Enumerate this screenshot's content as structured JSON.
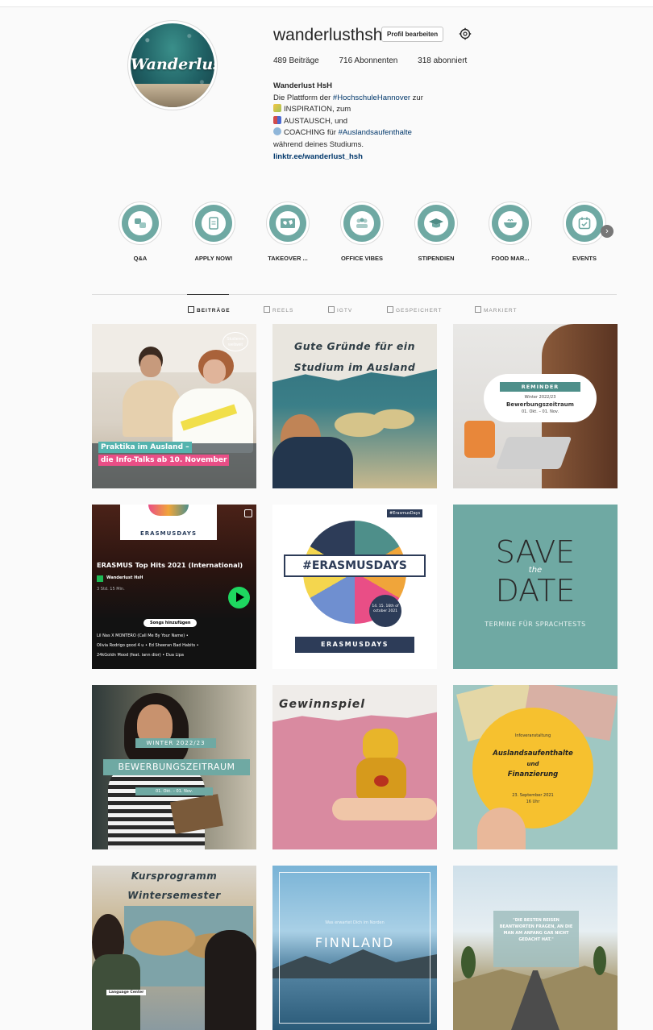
{
  "profile": {
    "username": "wanderlusthsh",
    "edit_label": "Profil bearbeiten",
    "avatar_text": "Wanderlust",
    "stats": {
      "posts": "489 Beiträge",
      "followers": "716 Abonnenten",
      "following": "318 abonniert"
    },
    "bio": {
      "name": "Wanderlust HsH",
      "line1_prefix": "Die Plattform der ",
      "line1_tag": "#HochschuleHannover",
      "line1_suffix": " zur",
      "line2": "INSPIRATION, zum",
      "line3": "AUSTAUSCH, und",
      "line4_prefix": "COACHING für ",
      "line4_tag": "#Auslandsaufenthalte",
      "line5": "während deines Studiums.",
      "link": "linktr.ee/wanderlust_hsh"
    }
  },
  "highlights": [
    {
      "label": "Q&A",
      "icon": "qa-icon"
    },
    {
      "label": "APPLY NOW!",
      "icon": "document-icon"
    },
    {
      "label": "TAKEOVER ...",
      "icon": "map-icon"
    },
    {
      "label": "OFFICE VIBES",
      "icon": "people-icon"
    },
    {
      "label": "STIPENDIEN",
      "icon": "graduation-cap-icon"
    },
    {
      "label": "FOOD MAR...",
      "icon": "food-bowl-icon"
    },
    {
      "label": "EVENTS",
      "icon": "calendar-icon"
    }
  ],
  "tabs": [
    {
      "label": "BEITRÄGE",
      "active": true
    },
    {
      "label": "REELS",
      "active": false
    },
    {
      "label": "IGTV",
      "active": false
    },
    {
      "label": "GESPEICHERT",
      "active": false
    },
    {
      "label": "MARKIERT",
      "active": false
    }
  ],
  "posts": {
    "p1": {
      "badge": "Studieren weltweit",
      "l1": "Praktika im Ausland –",
      "l2": "die Info-Talks ab 10. November"
    },
    "p2": {
      "l1": "Gute Gründe für ein",
      "l2": "Studium im Ausland"
    },
    "p3": {
      "badge": "REMINDER",
      "l1": "Winter 2022/23",
      "l2": "Bewerbungszeitraum",
      "l3": "01. Okt. – 01. Nov."
    },
    "p4": {
      "header": "ERASMUSDAYS",
      "title": "ERASMUS Top Hits 2021 (International)",
      "owner": "Wanderlust HsH",
      "meta": "3 Std. 15 Min.",
      "add": "Songs hinzufügen",
      "t1": "Lil Nas X MONTERO (Call Me By Your Name) •",
      "t2": "Olivia Rodrigo good 4 u • Ed Sheeran Bad Habits •",
      "t3": "24kGoldn Mood (feat. iann dior) • Dua Lipa"
    },
    "p5": {
      "tag": "#ErasmusDays",
      "banner": "#ERASMUSDAYS",
      "dates": "14. 15. 16th of october 2021",
      "footer": "ERASMUSDAYS"
    },
    "p6": {
      "l1": "SAVE",
      "l2": "the",
      "l3": "DATE",
      "sub": "TERMINE FÜR SPRACHTESTS"
    },
    "p7": {
      "l1": "WINTER 2022/23",
      "l2": "BEWERBUNGSZEITRAUM",
      "l3": "01. Okt. – 01. Nov."
    },
    "p8": {
      "l1": "Gewinnspiel"
    },
    "p9": {
      "small": "Infoveranstaltung",
      "l1": "Auslandsaufenthalte",
      "l2": "und",
      "l3": "Finanzierung",
      "d1": "23. September 2021",
      "d2": "16 Uhr"
    },
    "p10": {
      "l1": "Kursprogramm",
      "l2": "Wintersemester",
      "label": "Language Center"
    },
    "p11": {
      "small": "Was erwartet Dich im Norden",
      "l1": "FINNLAND"
    },
    "p12": {
      "quote": "\"DIE BESTEN REISEN BEANTWORTEN FRAGEN, AN DIE MAN AM ANFANG GAR NICHT GEDACHT HAT.\""
    }
  },
  "colors": {
    "teal": "#6fa9a3",
    "link": "#00376b"
  }
}
